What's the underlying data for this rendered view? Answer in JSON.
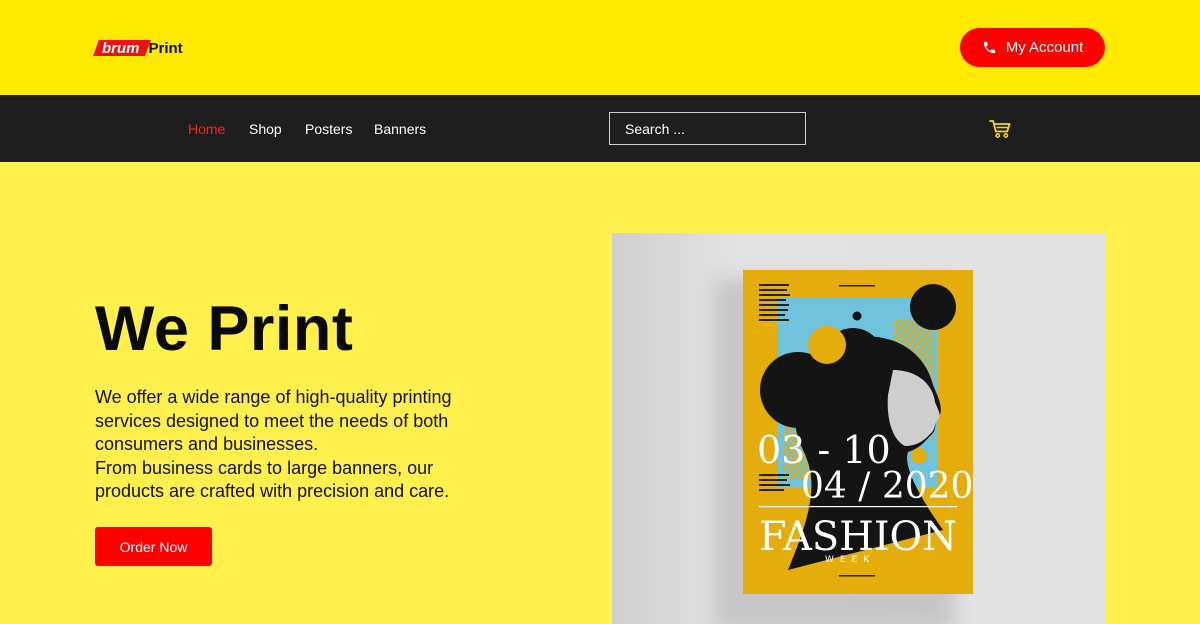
{
  "header": {
    "logo_brum": "brum",
    "logo_print": "Print",
    "account_label": "My Account",
    "account_icon": "phone-icon"
  },
  "nav": {
    "items": [
      {
        "label": "Home",
        "active": true
      },
      {
        "label": "Shop",
        "active": false
      },
      {
        "label": "Posters",
        "active": false
      },
      {
        "label": "Banners",
        "active": false
      }
    ],
    "search_placeholder": "Search ...",
    "cart_icon": "cart-icon"
  },
  "hero": {
    "title": "We Print",
    "description_1": "We offer a wide range of high-quality printing services designed to meet the needs of both consumers and businesses.",
    "description_2": "From business cards to large banners, our products are crafted with precision and care.",
    "cta_label": "Order Now"
  },
  "poster": {
    "date_line_1": "03 - 10",
    "date_line_2": "04 / 2020",
    "headline": "FASHION",
    "subheadline": "WEEK"
  },
  "colors": {
    "topbar": "#ffea00",
    "hero_bg": "#fff04d",
    "nav_bg": "#1e1e1e",
    "accent_red": "#ff0000",
    "poster_yellow": "#e5ad0c",
    "poster_blue": "#6fc3dc"
  }
}
